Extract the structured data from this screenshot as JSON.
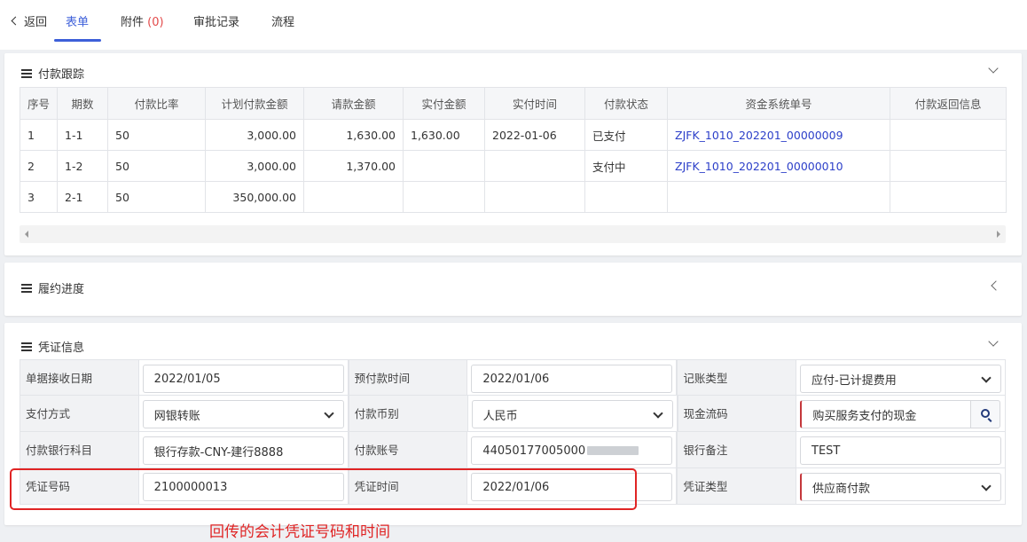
{
  "topbar": {
    "back_label": "返回",
    "tabs": [
      {
        "label": "表单"
      },
      {
        "label": "附件"
      },
      {
        "label": "审批记录"
      },
      {
        "label": "流程"
      }
    ],
    "attachment_count": "(0)"
  },
  "payment_tracking": {
    "title": "付款跟踪",
    "columns": [
      "序号",
      "期数",
      "付款比率",
      "计划付款金额",
      "请款金额",
      "实付金额",
      "实付时间",
      "付款状态",
      "资金系统单号",
      "付款返回信息"
    ],
    "rows": [
      {
        "no": "1",
        "period": "1-1",
        "ratio": "50",
        "planned": "3,000.00",
        "requested": "1,630.00",
        "paid": "1,630.00",
        "paid_time": "2022-01-06",
        "status": "已支付",
        "fund_no": "ZJFK_1010_202201_00000009",
        "return_info": ""
      },
      {
        "no": "2",
        "period": "1-2",
        "ratio": "50",
        "planned": "3,000.00",
        "requested": "1,370.00",
        "paid": "",
        "paid_time": "",
        "status": "支付中",
        "fund_no": "ZJFK_1010_202201_00000010",
        "return_info": ""
      },
      {
        "no": "3",
        "period": "2-1",
        "ratio": "50",
        "planned": "350,000.00",
        "requested": "",
        "paid": "",
        "paid_time": "",
        "status": "",
        "fund_no": "",
        "return_info": ""
      }
    ]
  },
  "performance": {
    "title": "履约进度"
  },
  "voucher": {
    "title": "凭证信息",
    "receive_date_label": "单据接收日期",
    "receive_date": "2022/01/05",
    "prepay_time_label": "预付款时间",
    "prepay_time": "2022/01/06",
    "account_type_label": "记账类型",
    "account_type": "应付-已计提费用",
    "pay_method_label": "支付方式",
    "pay_method": "网银转账",
    "currency_label": "付款币别",
    "currency": "人民币",
    "cash_flow_label": "现金流码",
    "cash_flow": "购买服务支付的现金",
    "bank_subject_label": "付款银行科目",
    "bank_subject": "银行存款-CNY-建行8888",
    "account_no_label": "付款账号",
    "account_no": "44050177005000",
    "bank_remark_label": "银行备注",
    "bank_remark": "TEST",
    "voucher_no_label": "凭证号码",
    "voucher_no": "2100000013",
    "voucher_time_label": "凭证时间",
    "voucher_time": "2022/01/06",
    "voucher_type_label": "凭证类型",
    "voucher_type": "供应商付款"
  },
  "annotation": "回传的会计凭证号码和时间",
  "colors": {
    "accent": "#3d5fd9",
    "link": "#2c3fc9",
    "highlight": "#e02424",
    "required": "#c4373b"
  }
}
